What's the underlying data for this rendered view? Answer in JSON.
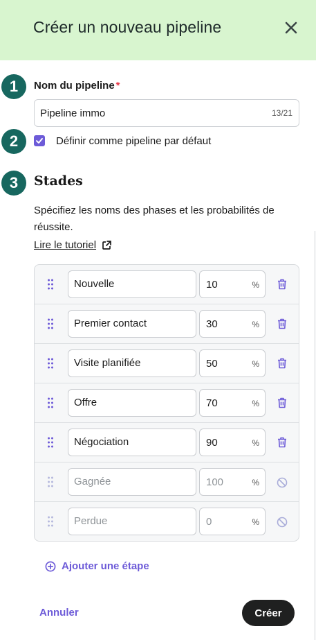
{
  "header": {
    "title": "Créer un nouveau pipeline",
    "close_icon": "close-icon"
  },
  "steps": [
    "1",
    "2",
    "3"
  ],
  "pipeline_name": {
    "label": "Nom du pipeline",
    "required_mark": "*",
    "value": "Pipeline immo",
    "char_count": "13/21"
  },
  "default_checkbox": {
    "label": "Définir comme pipeline par défaut",
    "checked": true
  },
  "stages_section": {
    "title": "Stades",
    "description": "Spécifiez les noms des phases et les probabilités de réussite.",
    "tutorial_link": "Lire le tutoriel",
    "percent_sign": "%",
    "rows": [
      {
        "name": "Nouvelle",
        "probability": "10",
        "deletable": true
      },
      {
        "name": "Premier contact",
        "probability": "30",
        "deletable": true
      },
      {
        "name": "Visite planifiée",
        "probability": "50",
        "deletable": true
      },
      {
        "name": "Offre",
        "probability": "70",
        "deletable": true
      },
      {
        "name": "Négociation",
        "probability": "90",
        "deletable": true
      },
      {
        "name": "Gagnée",
        "probability": "100",
        "deletable": false
      },
      {
        "name": "Perdue",
        "probability": "0",
        "deletable": false
      }
    ]
  },
  "add_step_label": "Ajouter une étape",
  "footer": {
    "cancel_label": "Annuler",
    "create_label": "Créer"
  },
  "colors": {
    "accent": "#6d5bd8",
    "header_bg": "#d8f5cf",
    "step_badge": "#17675f",
    "required": "#e53b4a",
    "primary_button": "#1f2020"
  }
}
